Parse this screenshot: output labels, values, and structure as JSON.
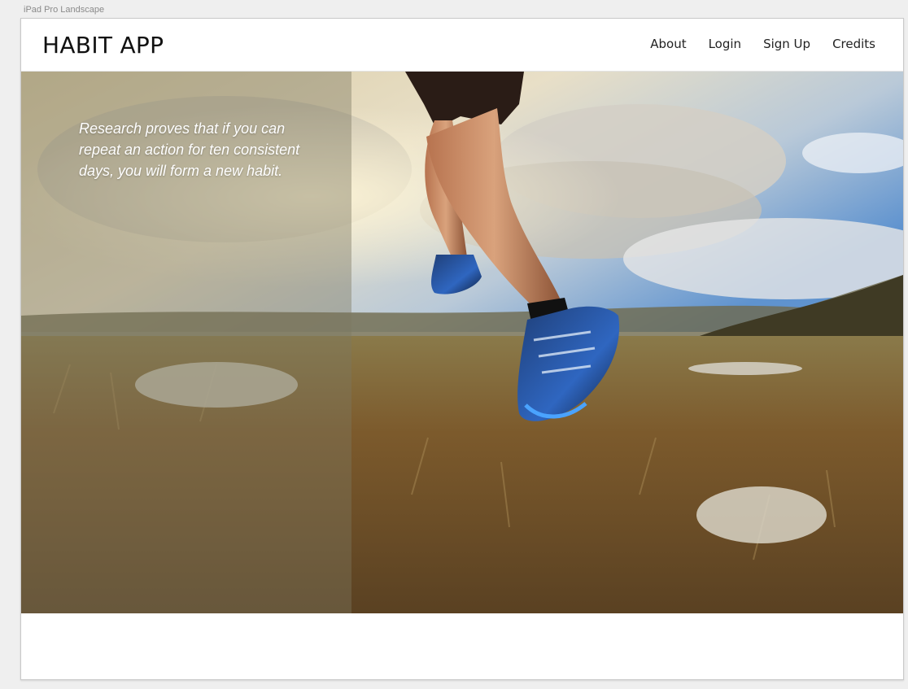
{
  "canvas": {
    "label": "iPad Pro Landscape"
  },
  "navbar": {
    "brand": "HABIT APP",
    "links": [
      {
        "label": "About"
      },
      {
        "label": "Login"
      },
      {
        "label": "Sign Up"
      },
      {
        "label": "Credits"
      }
    ]
  },
  "hero": {
    "quote": "Research proves that if you can repeat an action for ten consistent days, you will form a new habit.",
    "image": "runner-on-hillside-photo"
  },
  "colors": {
    "overlay": "#7d7660",
    "nav_text": "#222222",
    "brand_text": "#111111"
  }
}
